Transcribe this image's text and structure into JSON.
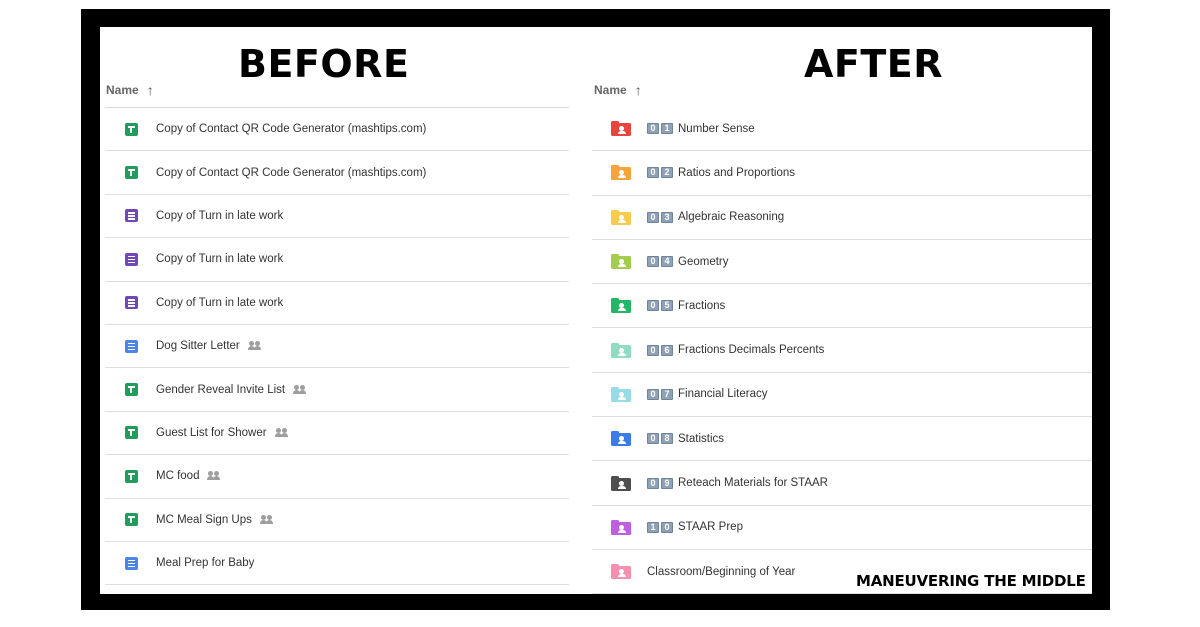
{
  "headings": {
    "before": "BEFORE",
    "after": "AFTER"
  },
  "column_header": {
    "label": "Name",
    "sort_icon": "arrow-up-icon"
  },
  "before_files": [
    {
      "name": "Copy of Contact QR Code Generator (mashtips.com)",
      "type": "sheet",
      "shared": false
    },
    {
      "name": "Copy of Contact QR Code Generator (mashtips.com)",
      "type": "sheet",
      "shared": false
    },
    {
      "name": "Copy of Turn in late work",
      "type": "form",
      "shared": false
    },
    {
      "name": "Copy of Turn in late work",
      "type": "form",
      "shared": false
    },
    {
      "name": "Copy of Turn in late work",
      "type": "form",
      "shared": false
    },
    {
      "name": "Dog Sitter Letter",
      "type": "doc",
      "shared": true
    },
    {
      "name": "Gender Reveal Invite List",
      "type": "sheet",
      "shared": true
    },
    {
      "name": "Guest List for Shower",
      "type": "sheet",
      "shared": true
    },
    {
      "name": "MC food",
      "type": "sheet",
      "shared": true
    },
    {
      "name": "MC Meal Sign Ups",
      "type": "sheet",
      "shared": true
    },
    {
      "name": "Meal Prep for Baby",
      "type": "doc",
      "shared": false
    }
  ],
  "after_folders": [
    {
      "digits": [
        "0",
        "1"
      ],
      "name": "Number Sense",
      "color": "#e8453c"
    },
    {
      "digits": [
        "0",
        "2"
      ],
      "name": "Ratios and Proportions",
      "color": "#f6a33a"
    },
    {
      "digits": [
        "0",
        "3"
      ],
      "name": "Algebraic Reasoning",
      "color": "#f7cb4d"
    },
    {
      "digits": [
        "0",
        "4"
      ],
      "name": "Geometry",
      "color": "#a4cd4d"
    },
    {
      "digits": [
        "0",
        "5"
      ],
      "name": "Fractions",
      "color": "#21b765"
    },
    {
      "digits": [
        "0",
        "6"
      ],
      "name": "Fractions Decimals Percents",
      "color": "#8fdcc2"
    },
    {
      "digits": [
        "0",
        "7"
      ],
      "name": "Financial Literacy",
      "color": "#96dbe6"
    },
    {
      "digits": [
        "0",
        "8"
      ],
      "name": "Statistics",
      "color": "#3b7de8"
    },
    {
      "digits": [
        "0",
        "9"
      ],
      "name": "Reteach Materials for STAAR",
      "color": "#4f4f4f"
    },
    {
      "digits": [
        "1",
        "0"
      ],
      "name": "STAAR Prep",
      "color": "#c05ee0"
    },
    {
      "digits": [],
      "name": "Classroom/Beginning of Year",
      "color": "#f590b0"
    }
  ],
  "brand": "MANEUVERING THE MIDDLE"
}
